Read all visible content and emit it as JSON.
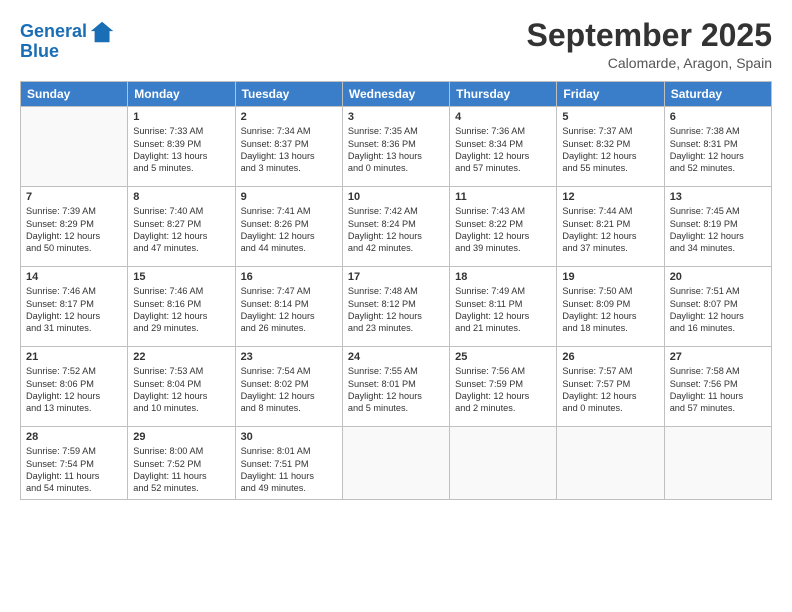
{
  "logo": {
    "line1": "General",
    "line2": "Blue"
  },
  "title": "September 2025",
  "location": "Calomarde, Aragon, Spain",
  "days_header": [
    "Sunday",
    "Monday",
    "Tuesday",
    "Wednesday",
    "Thursday",
    "Friday",
    "Saturday"
  ],
  "weeks": [
    [
      {
        "day": "",
        "info": ""
      },
      {
        "day": "1",
        "info": "Sunrise: 7:33 AM\nSunset: 8:39 PM\nDaylight: 13 hours\nand 5 minutes."
      },
      {
        "day": "2",
        "info": "Sunrise: 7:34 AM\nSunset: 8:37 PM\nDaylight: 13 hours\nand 3 minutes."
      },
      {
        "day": "3",
        "info": "Sunrise: 7:35 AM\nSunset: 8:36 PM\nDaylight: 13 hours\nand 0 minutes."
      },
      {
        "day": "4",
        "info": "Sunrise: 7:36 AM\nSunset: 8:34 PM\nDaylight: 12 hours\nand 57 minutes."
      },
      {
        "day": "5",
        "info": "Sunrise: 7:37 AM\nSunset: 8:32 PM\nDaylight: 12 hours\nand 55 minutes."
      },
      {
        "day": "6",
        "info": "Sunrise: 7:38 AM\nSunset: 8:31 PM\nDaylight: 12 hours\nand 52 minutes."
      }
    ],
    [
      {
        "day": "7",
        "info": "Sunrise: 7:39 AM\nSunset: 8:29 PM\nDaylight: 12 hours\nand 50 minutes."
      },
      {
        "day": "8",
        "info": "Sunrise: 7:40 AM\nSunset: 8:27 PM\nDaylight: 12 hours\nand 47 minutes."
      },
      {
        "day": "9",
        "info": "Sunrise: 7:41 AM\nSunset: 8:26 PM\nDaylight: 12 hours\nand 44 minutes."
      },
      {
        "day": "10",
        "info": "Sunrise: 7:42 AM\nSunset: 8:24 PM\nDaylight: 12 hours\nand 42 minutes."
      },
      {
        "day": "11",
        "info": "Sunrise: 7:43 AM\nSunset: 8:22 PM\nDaylight: 12 hours\nand 39 minutes."
      },
      {
        "day": "12",
        "info": "Sunrise: 7:44 AM\nSunset: 8:21 PM\nDaylight: 12 hours\nand 37 minutes."
      },
      {
        "day": "13",
        "info": "Sunrise: 7:45 AM\nSunset: 8:19 PM\nDaylight: 12 hours\nand 34 minutes."
      }
    ],
    [
      {
        "day": "14",
        "info": "Sunrise: 7:46 AM\nSunset: 8:17 PM\nDaylight: 12 hours\nand 31 minutes."
      },
      {
        "day": "15",
        "info": "Sunrise: 7:46 AM\nSunset: 8:16 PM\nDaylight: 12 hours\nand 29 minutes."
      },
      {
        "day": "16",
        "info": "Sunrise: 7:47 AM\nSunset: 8:14 PM\nDaylight: 12 hours\nand 26 minutes."
      },
      {
        "day": "17",
        "info": "Sunrise: 7:48 AM\nSunset: 8:12 PM\nDaylight: 12 hours\nand 23 minutes."
      },
      {
        "day": "18",
        "info": "Sunrise: 7:49 AM\nSunset: 8:11 PM\nDaylight: 12 hours\nand 21 minutes."
      },
      {
        "day": "19",
        "info": "Sunrise: 7:50 AM\nSunset: 8:09 PM\nDaylight: 12 hours\nand 18 minutes."
      },
      {
        "day": "20",
        "info": "Sunrise: 7:51 AM\nSunset: 8:07 PM\nDaylight: 12 hours\nand 16 minutes."
      }
    ],
    [
      {
        "day": "21",
        "info": "Sunrise: 7:52 AM\nSunset: 8:06 PM\nDaylight: 12 hours\nand 13 minutes."
      },
      {
        "day": "22",
        "info": "Sunrise: 7:53 AM\nSunset: 8:04 PM\nDaylight: 12 hours\nand 10 minutes."
      },
      {
        "day": "23",
        "info": "Sunrise: 7:54 AM\nSunset: 8:02 PM\nDaylight: 12 hours\nand 8 minutes."
      },
      {
        "day": "24",
        "info": "Sunrise: 7:55 AM\nSunset: 8:01 PM\nDaylight: 12 hours\nand 5 minutes."
      },
      {
        "day": "25",
        "info": "Sunrise: 7:56 AM\nSunset: 7:59 PM\nDaylight: 12 hours\nand 2 minutes."
      },
      {
        "day": "26",
        "info": "Sunrise: 7:57 AM\nSunset: 7:57 PM\nDaylight: 12 hours\nand 0 minutes."
      },
      {
        "day": "27",
        "info": "Sunrise: 7:58 AM\nSunset: 7:56 PM\nDaylight: 11 hours\nand 57 minutes."
      }
    ],
    [
      {
        "day": "28",
        "info": "Sunrise: 7:59 AM\nSunset: 7:54 PM\nDaylight: 11 hours\nand 54 minutes."
      },
      {
        "day": "29",
        "info": "Sunrise: 8:00 AM\nSunset: 7:52 PM\nDaylight: 11 hours\nand 52 minutes."
      },
      {
        "day": "30",
        "info": "Sunrise: 8:01 AM\nSunset: 7:51 PM\nDaylight: 11 hours\nand 49 minutes."
      },
      {
        "day": "",
        "info": ""
      },
      {
        "day": "",
        "info": ""
      },
      {
        "day": "",
        "info": ""
      },
      {
        "day": "",
        "info": ""
      }
    ]
  ]
}
